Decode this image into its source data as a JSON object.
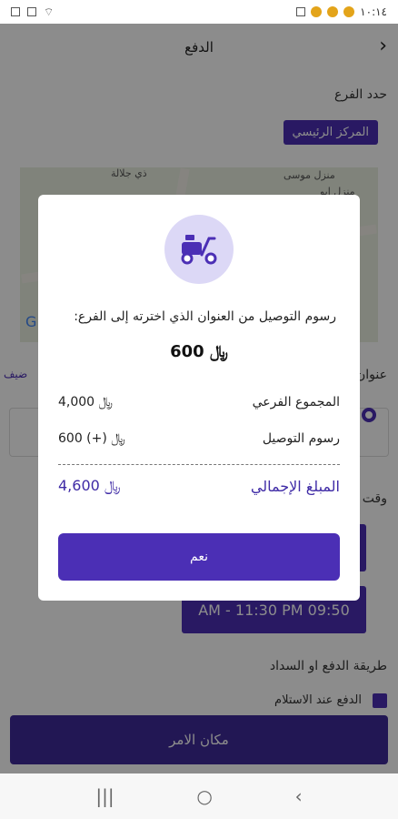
{
  "status_bar": {
    "time": "١٠:١٤"
  },
  "header": {
    "title": "الدفع",
    "back_icon": "›"
  },
  "select_branch": {
    "label": "حدد الفرع",
    "selected": "المركز الرئيسي"
  },
  "map": {
    "places": [
      "ذي جلالة",
      "منزل موسى",
      "منزل ابو"
    ],
    "marker": "G"
  },
  "address_label": "عنوان",
  "address_side_label": "ضيف",
  "delivery_time_label": "وقت",
  "time_slot": "AM - 11:30 PM 09:50",
  "payment": {
    "label": "طريقة الدفع او السداد",
    "option": "الدفع عند الاستلام"
  },
  "place_order": "مكان الامر",
  "modal": {
    "icon": "scooter-icon",
    "message": "رسوم التوصيل من العنوان الذي اخترته إلى الفرع:",
    "fee": "600",
    "currency": "﷼",
    "subtotal_label": "المجموع الفرعي",
    "subtotal_value": "4,000",
    "delivery_label": "رسوم التوصيل",
    "delivery_value": "(+) 600",
    "total_label": "المبلغ الإجمالي",
    "total_value": "4,600",
    "ok_button": "نعم"
  },
  "nav": {
    "recent": "|||",
    "home": "○",
    "back": "‹"
  },
  "colors": {
    "accent": "#4b2fb5",
    "overlay": "rgba(0,0,0,0.45)"
  }
}
